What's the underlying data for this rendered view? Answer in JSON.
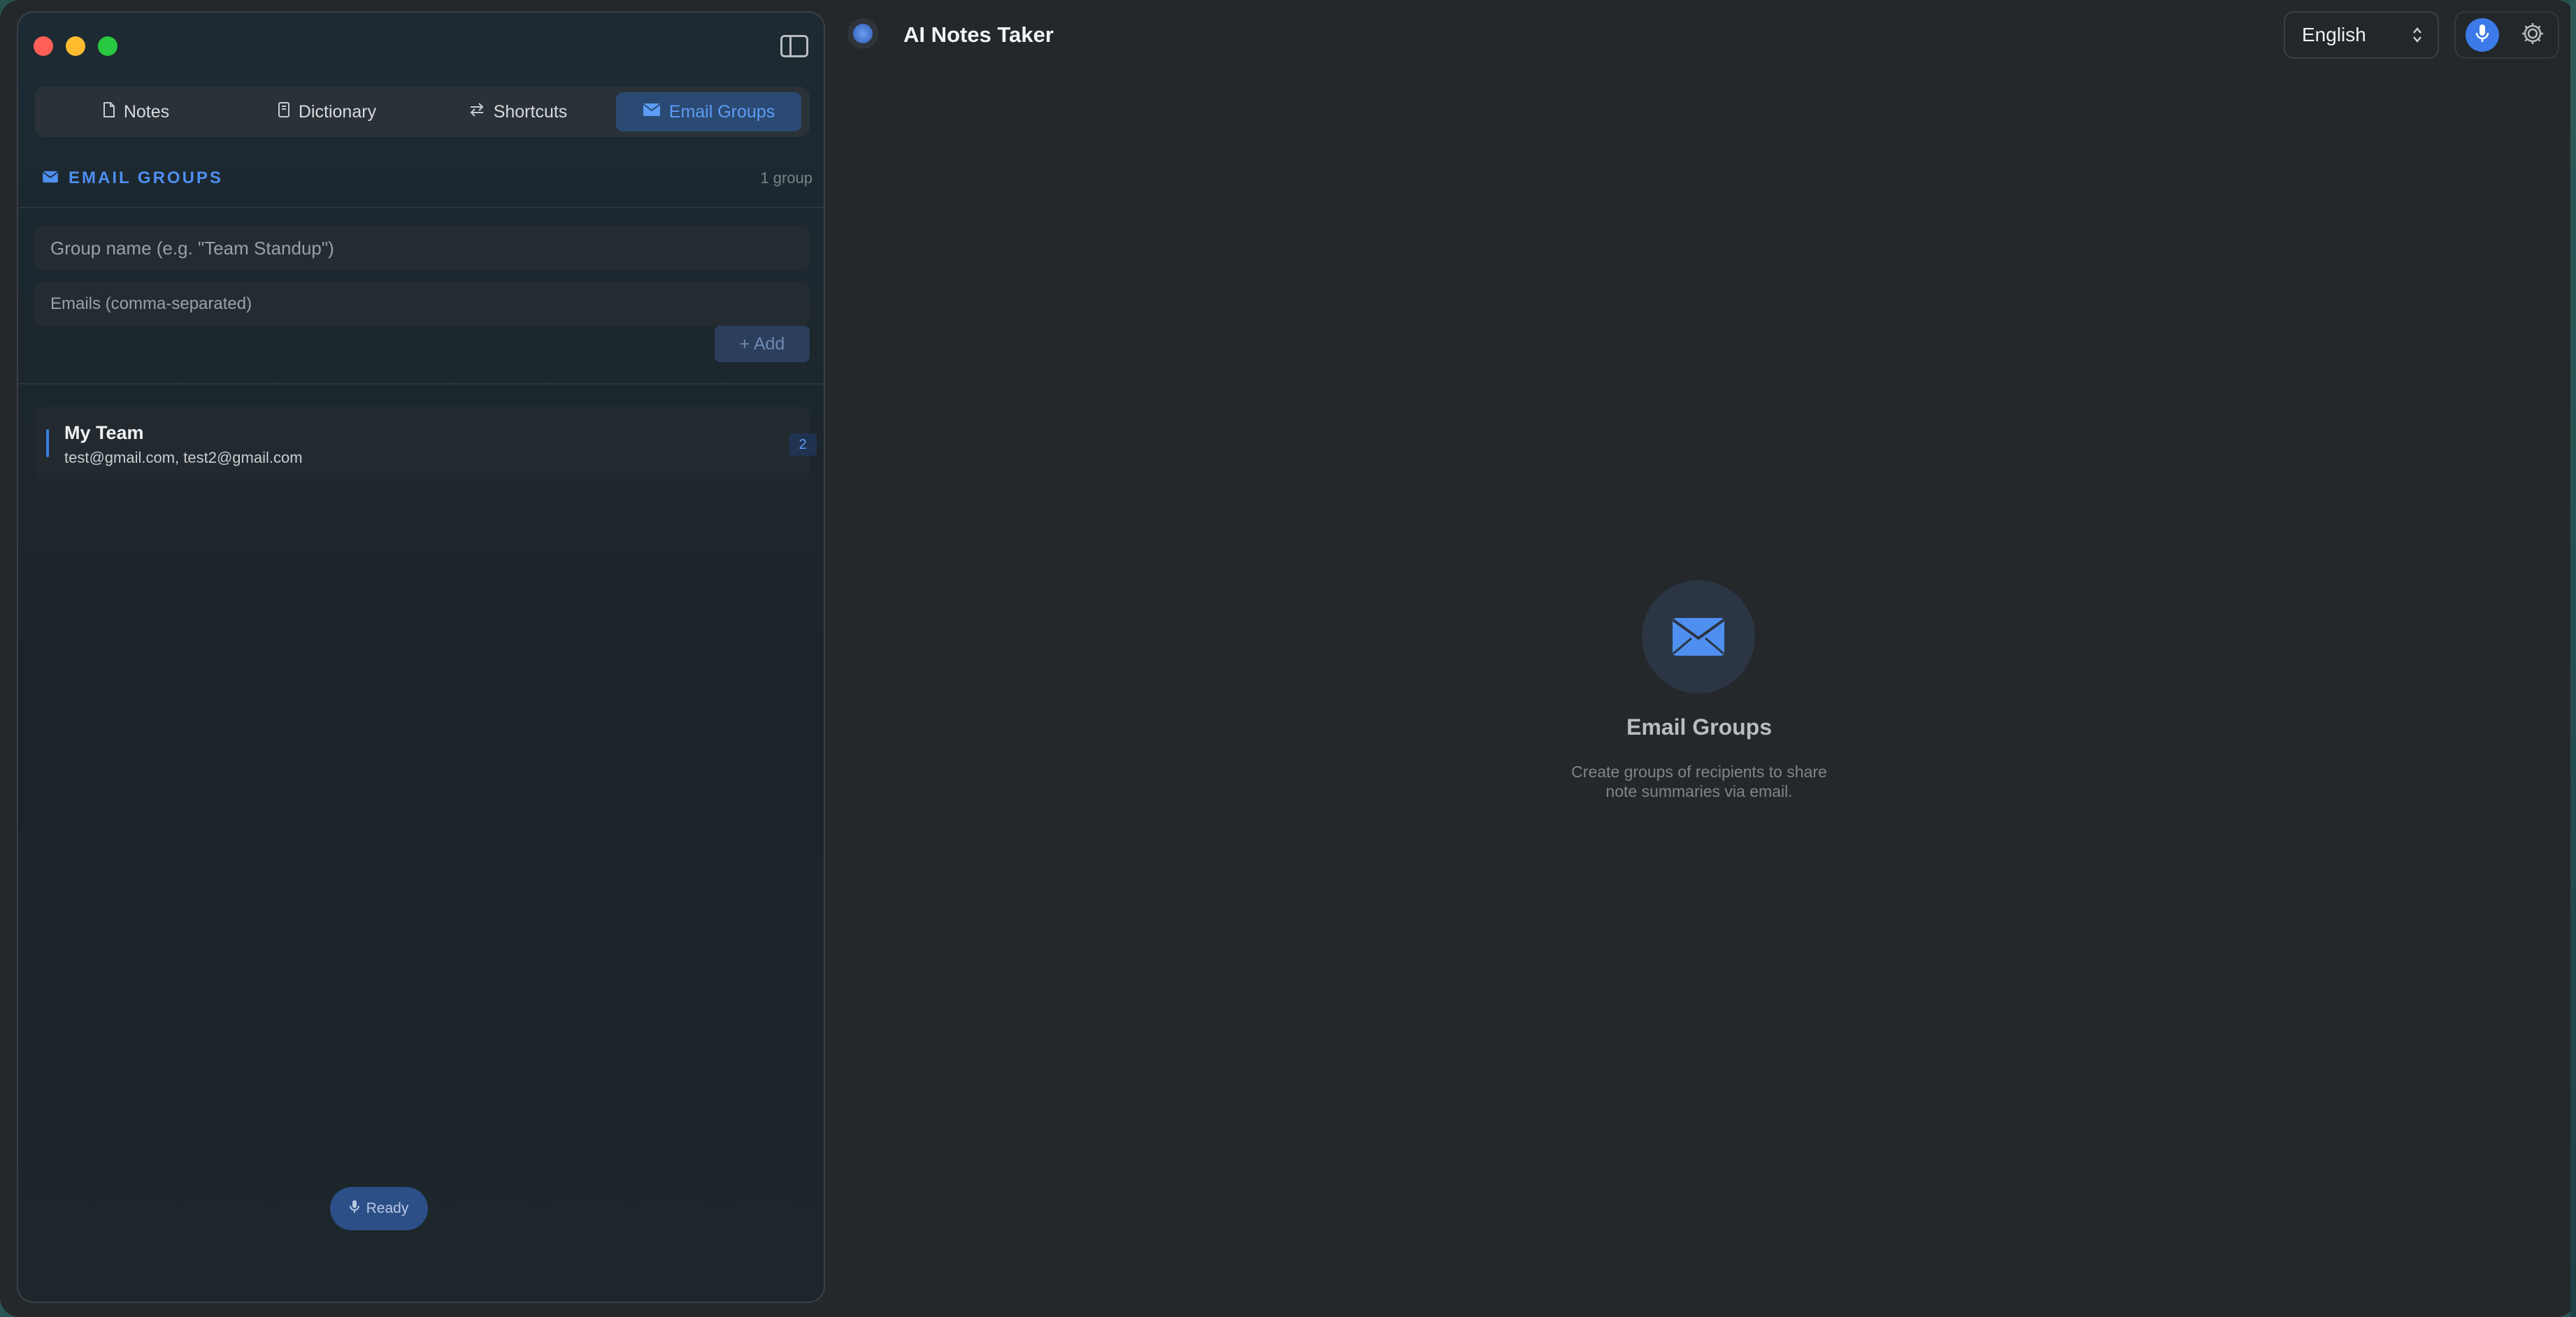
{
  "window": {
    "title": "AI Notes Taker"
  },
  "sidebar": {
    "tabs": [
      {
        "label": "Notes",
        "icon": "note-icon"
      },
      {
        "label": "Dictionary",
        "icon": "book-icon"
      },
      {
        "label": "Shortcuts",
        "icon": "swap-arrows-icon"
      },
      {
        "label": "Email Groups",
        "icon": "envelope-icon",
        "active": true
      }
    ],
    "section": {
      "title": "EMAIL GROUPS",
      "count": "1 group"
    },
    "form": {
      "group_name_placeholder": "Group name (e.g. \"Team Standup\")",
      "emails_placeholder": "Emails (comma-separated)",
      "add_label": "+ Add"
    },
    "groups": [
      {
        "name": "My Team",
        "emails": "test@gmail.com, test2@gmail.com",
        "count": "2"
      }
    ],
    "status": {
      "label": "Ready"
    }
  },
  "header": {
    "language": "English"
  },
  "empty_state": {
    "title": "Email Groups",
    "description_line1": "Create groups of recipients to share",
    "description_line2": "note summaries via email."
  },
  "colors": {
    "accent": "#4f8ff0",
    "active_tab_bg": "#2b4a73",
    "window_bg": "#24282b",
    "traffic_red": "#ff5f57",
    "traffic_yellow": "#febc2e",
    "traffic_green": "#28c840"
  }
}
